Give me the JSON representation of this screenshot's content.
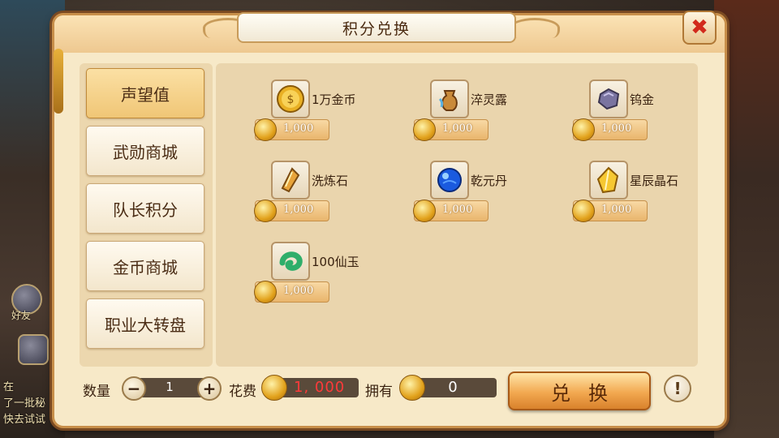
{
  "background": {
    "chat_lines": [
      "在",
      "了一批秘",
      "快去试试"
    ],
    "left_labels": [
      "好友"
    ]
  },
  "dialog": {
    "title": "积分兑换",
    "close_glyph": "✖"
  },
  "nav": {
    "items": [
      {
        "label": "声望值",
        "active": true
      },
      {
        "label": "武勋商城",
        "active": false
      },
      {
        "label": "队长积分",
        "active": false
      },
      {
        "label": "金币商城",
        "active": false
      },
      {
        "label": "职业大转盘",
        "active": false
      }
    ]
  },
  "items": [
    {
      "name": "1万金币",
      "price": "1,000",
      "icon": "gold-coin-icon"
    },
    {
      "name": "淬灵露",
      "price": "1,000",
      "icon": "potion-pot-icon"
    },
    {
      "name": "钨金",
      "price": "1,000",
      "icon": "tungsten-ore-icon"
    },
    {
      "name": "洗炼石",
      "price": "1,000",
      "icon": "refining-stone-icon"
    },
    {
      "name": "乾元丹",
      "price": "1,000",
      "icon": "blue-pill-icon"
    },
    {
      "name": "星辰晶石",
      "price": "1,000",
      "icon": "star-crystal-icon"
    },
    {
      "name": "100仙玉",
      "price": "1,000",
      "icon": "jade-icon"
    }
  ],
  "footer": {
    "qty_label": "数量",
    "qty_value": "1",
    "minus": "−",
    "plus": "+",
    "cost_label": "花费",
    "cost_value": "1, 000",
    "own_label": "拥有",
    "own_value": "0",
    "exchange_label": "兑换",
    "help_glyph": "!"
  },
  "colors": {
    "panel": "#f7e9c8",
    "border": "#c88f4a",
    "cost_red": "#ff3a3a",
    "button_orange": "#f2a850"
  }
}
